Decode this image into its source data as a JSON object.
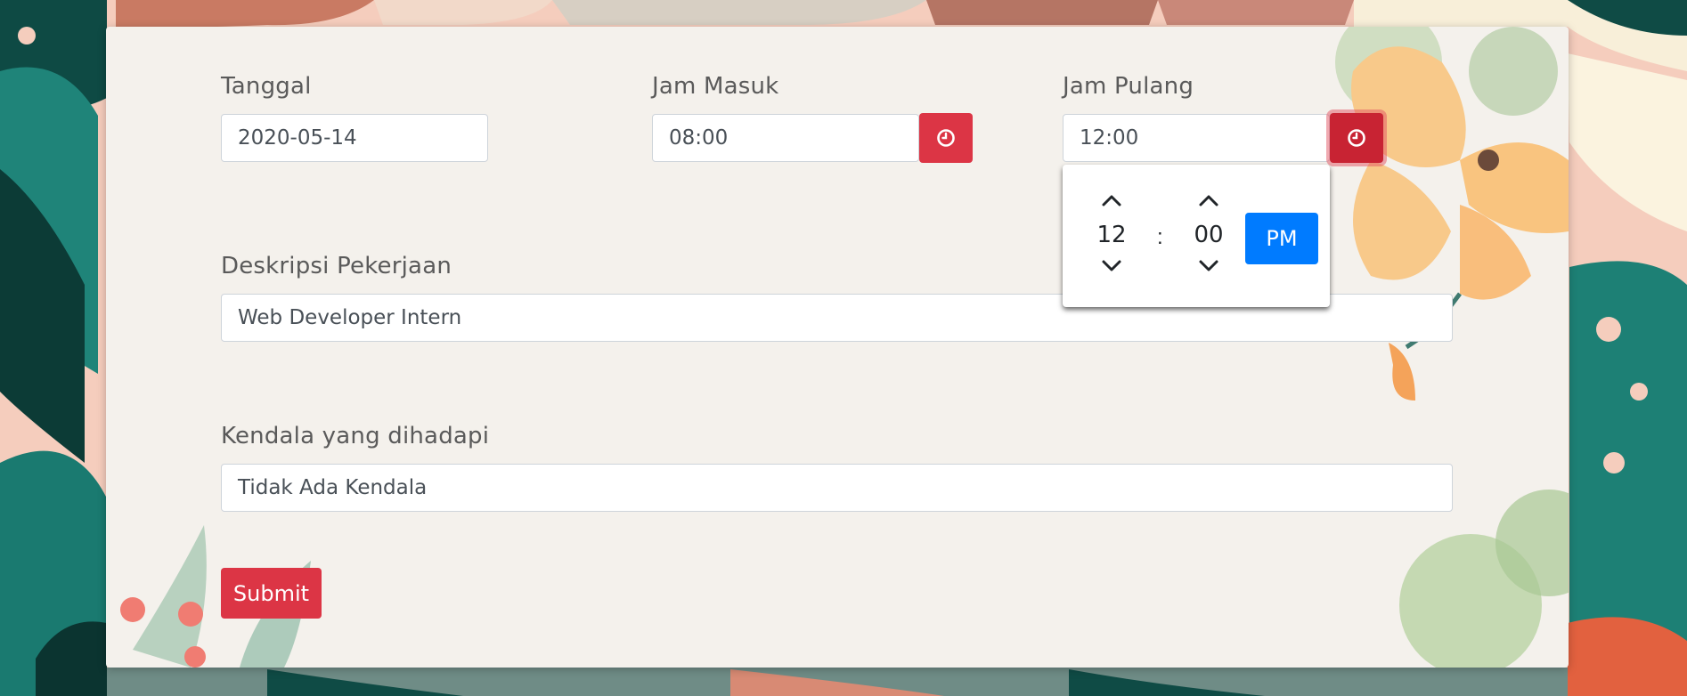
{
  "form": {
    "tanggal": {
      "label": "Tanggal",
      "value": "2020-05-14"
    },
    "jam_masuk": {
      "label": "Jam Masuk",
      "value": "08:00"
    },
    "jam_pulang": {
      "label": "Jam Pulang",
      "value": "12:00"
    },
    "deskripsi": {
      "label": "Deskripsi Pekerjaan",
      "value": "Web Developer Intern"
    },
    "kendala": {
      "label": "Kendala yang dihadapi",
      "value": "Tidak Ada Kendala"
    },
    "submit_label": "Submit"
  },
  "timepicker": {
    "hour": "12",
    "separator": ":",
    "minute": "00",
    "meridian": "PM"
  },
  "icons": {
    "clock": "clock-icon",
    "up": "chevron-up-icon",
    "down": "chevron-down-icon"
  },
  "colors": {
    "danger": "#dc3545",
    "primary": "#007bff",
    "card_bg": "#f4f1ec",
    "label_text": "#5a5a5a"
  }
}
